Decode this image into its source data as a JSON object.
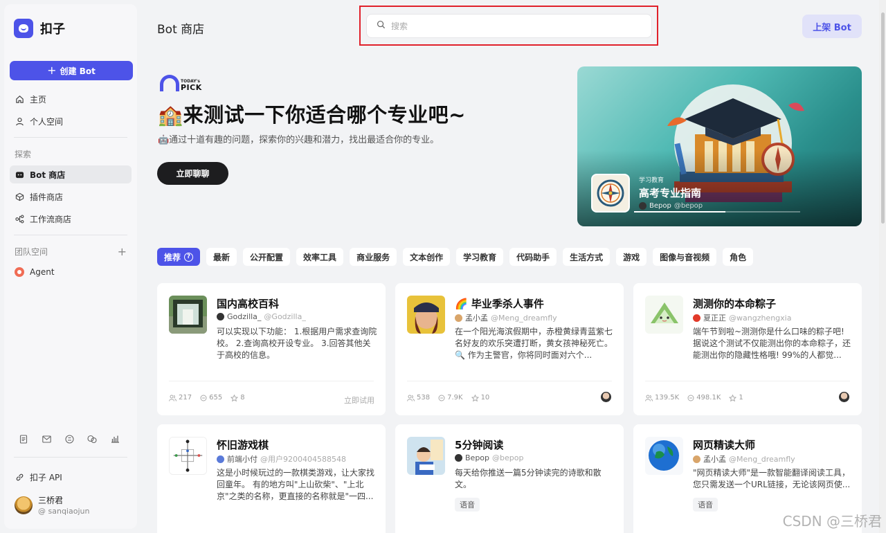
{
  "app": {
    "name": "扣子"
  },
  "sidebar": {
    "create_label": "创建 Bot",
    "nav_top": [
      {
        "label": "主页",
        "icon": "home-icon"
      },
      {
        "label": "个人空间",
        "icon": "user-icon"
      }
    ],
    "explore_label": "探索",
    "explore_items": [
      {
        "label": "Bot 商店",
        "icon": "bot-icon",
        "active": true
      },
      {
        "label": "插件商店",
        "icon": "plugin-icon",
        "active": false
      },
      {
        "label": "工作流商店",
        "icon": "workflow-icon",
        "active": false
      }
    ],
    "team_label": "团队空间",
    "team_items": [
      {
        "label": "Agent"
      }
    ],
    "footer_icons": [
      "document-icon",
      "mail-icon",
      "discord-icon",
      "chat-icon",
      "chart-icon"
    ],
    "api_label": "扣子 API",
    "user": {
      "name": "三桥君",
      "handle": "@ sanqiaojun"
    }
  },
  "header": {
    "title": "Bot 商店",
    "search_placeholder": "搜索",
    "list_button": "上架 Bot"
  },
  "hero": {
    "pick_small": "TODAY's",
    "pick_big": "PICK",
    "title": "🏫来测试一下你适合哪个专业吧~",
    "description": "🤖通过十道有趣的问题，探索你的兴趣和潜力，找出最适合你的专业。",
    "cta": "立即聊聊",
    "card": {
      "tag": "学习教育",
      "bot_name": "高考专业指南",
      "author": "Bepop",
      "handle": "@bepop",
      "progress": 0.55
    }
  },
  "tabs": [
    {
      "label": "推荐",
      "active": true
    },
    {
      "label": "最新"
    },
    {
      "label": "公开配置"
    },
    {
      "label": "效率工具"
    },
    {
      "label": "商业服务"
    },
    {
      "label": "文本创作"
    },
    {
      "label": "学习教育"
    },
    {
      "label": "代码助手"
    },
    {
      "label": "生活方式"
    },
    {
      "label": "游戏"
    },
    {
      "label": "图像与音视频"
    },
    {
      "label": "角色"
    }
  ],
  "cards": [
    {
      "name": "国内高校百科",
      "author": "Godzilla_",
      "handle": "@Godzilla_",
      "desc": "可以实现以下功能： 1.根据用户需求查询院校。 2.查询高校开设专业。 3.回答其他关于高校的信息。",
      "users": "217",
      "chats": "655",
      "stars": "8",
      "try": "立即试用"
    },
    {
      "name": "🌈 毕业季杀人事件",
      "author": "孟小孟",
      "handle": "@Meng_dreamfly",
      "desc": "在一个阳光海滨假期中，赤橙黄绿青蓝紫七名好友的欢乐突遭打断，黄女孩神秘死亡。🔍 作为主警官，你将同时面对六个...",
      "users": "538",
      "chats": "7.9K",
      "stars": "10"
    },
    {
      "name": "测测你的本命粽子",
      "author": "夏正正",
      "handle": "@wangzhengxia",
      "desc": "端午节到啦~测测你是什么口味的粽子吧! 据说这个测试不仅能测出你的本命粽子，还能测出你的隐藏性格哦! 99%的人都觉...",
      "users": "139.5K",
      "chats": "498.1K",
      "stars": "1"
    },
    {
      "name": "怀旧游戏棋",
      "author": "前端小付",
      "handle": "@用户9200404588548",
      "desc": "这是小时候玩过的一款棋类游戏，让大家找回童年。 有的地方叫\"上山砍柴\"、\"上北京\"之类的名称，更直接的名称就是\"一四..."
    },
    {
      "name": "5分钟阅读",
      "author": "Bepop",
      "handle": "@bepop",
      "desc": "每天给你推送一篇5分钟读完的诗歌和散文。",
      "badge": "语音"
    },
    {
      "name": "网页精读大师",
      "author": "孟小孟",
      "handle": "@Meng_dreamfly",
      "desc": "\"网页精读大师\"是一款智能翻译阅读工具，您只需发送一个URL链接，无论该网页使...",
      "badge": "语音"
    }
  ],
  "watermark": "CSDN @三桥君"
}
